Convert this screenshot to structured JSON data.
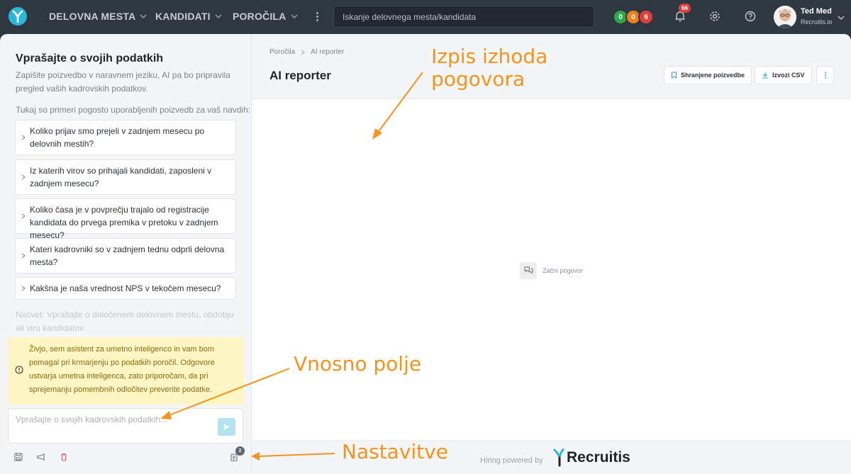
{
  "topbar": {
    "nav": [
      {
        "label": "DELOVNA MESTA"
      },
      {
        "label": "KANDIDATI"
      },
      {
        "label": "POROČILA"
      }
    ],
    "search_placeholder": "Iskanje delovnega mesta/kandidata",
    "status_counts": [
      {
        "value": "0",
        "color": "#2ea84a"
      },
      {
        "value": "0",
        "color": "#f07f1c"
      },
      {
        "value": "6",
        "color": "#e23d3d"
      }
    ],
    "notification_count": "66",
    "user": {
      "name": "Ted Med",
      "org": "Recruitis.io"
    }
  },
  "sidebar": {
    "title": "Vprašajte o svojih podatkih",
    "lead": "Zapišite poizvedbo v naravnem jeziku, AI pa bo pripravila pregled vaših kadrovskih podatkov.",
    "examples_title": "Tukaj so primeri pogosto uporabljenih poizvedb za vaš navdih:",
    "examples": [
      "Koliko prijav smo prejeli v zadnjem mesecu po delovnih mestih?",
      "Iz katerih virov so prihajali kandidati, zaposleni v zadnjem mesecu?",
      "Koliko časa je v povprečju trajalo od registracije kandidata do prvega premika v pretoku v zadnjem mesecu?",
      "Kateri kadrovniki so v zadnjem tednu odprli delovna mesta?",
      "Kakšna je naša vrednost NPS v tekočem mesecu?"
    ],
    "hint": "Nasvet: Vprašajte o določenem delovnem mestu, obdobju ali viru kandidatov.",
    "warning": "Živjo, sem asistent za umetno inteligenco in vam bom pomagal pri krmarjenju po podatkih poročil. Odgovore ustvarja umetna inteligenca, zato priporočam, da pri sprejemanju pomembnih odločitev preverite podatke.",
    "input_placeholder": "Vprašajte o svojih kadrovskih podatkih...",
    "settings_badge": "2"
  },
  "main": {
    "breadcrumb": [
      "Poročila",
      "AI reporter"
    ],
    "title": "AI reporter",
    "buttons": {
      "saved": "Shranjene poizvedbe",
      "export": "Izvozi CSV"
    },
    "empty_label": "Začni pogovor",
    "footer_powered": "Hiring powered by",
    "brand": "Recruitis"
  },
  "annotations": {
    "output": [
      "Izpis izhoda",
      "pogovora"
    ],
    "input": "Vnosno polje",
    "settings": "Nastavitve"
  },
  "colors": {
    "accent": "#2bb7d9",
    "annotation": "#f4931e"
  }
}
